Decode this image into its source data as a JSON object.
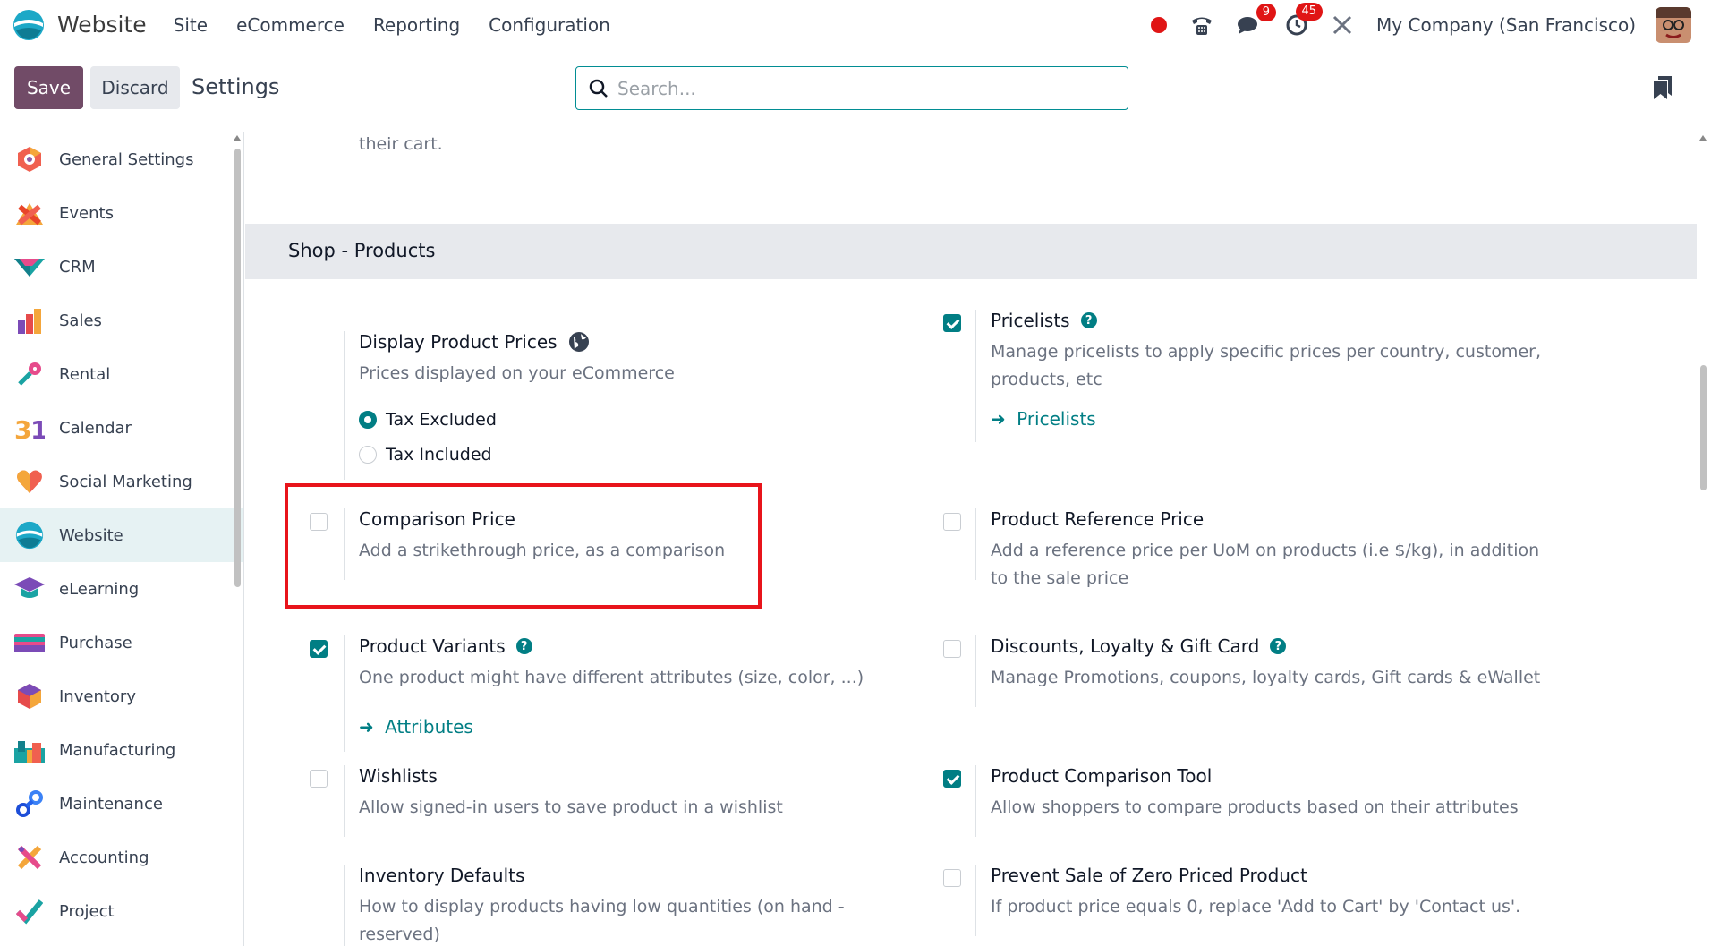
{
  "navbar": {
    "app_title": "Website",
    "menu": [
      "Site",
      "eCommerce",
      "Reporting",
      "Configuration"
    ],
    "messages_count": "9",
    "activities_count": "45",
    "company": "My Company (San Francisco)"
  },
  "controls": {
    "save_label": "Save",
    "discard_label": "Discard",
    "title": "Settings",
    "search_placeholder": "Search..."
  },
  "sidebar": {
    "items": [
      {
        "label": "General Settings",
        "icon": "general-settings-icon"
      },
      {
        "label": "Events",
        "icon": "events-icon"
      },
      {
        "label": "CRM",
        "icon": "crm-icon"
      },
      {
        "label": "Sales",
        "icon": "sales-icon"
      },
      {
        "label": "Rental",
        "icon": "rental-icon"
      },
      {
        "label": "Calendar",
        "icon": "calendar-icon"
      },
      {
        "label": "Social Marketing",
        "icon": "social-marketing-icon"
      },
      {
        "label": "Website",
        "icon": "website-icon",
        "active": true
      },
      {
        "label": "eLearning",
        "icon": "elearning-icon"
      },
      {
        "label": "Purchase",
        "icon": "purchase-icon"
      },
      {
        "label": "Inventory",
        "icon": "inventory-icon"
      },
      {
        "label": "Manufacturing",
        "icon": "manufacturing-icon"
      },
      {
        "label": "Maintenance",
        "icon": "maintenance-icon"
      },
      {
        "label": "Accounting",
        "icon": "accounting-icon"
      },
      {
        "label": "Project",
        "icon": "project-icon"
      }
    ]
  },
  "main": {
    "cart_text": "their cart.",
    "section_title": "Shop - Products",
    "display_prices": {
      "title": "Display Product Prices",
      "desc": "Prices displayed on your eCommerce",
      "options": [
        "Tax Excluded",
        "Tax Included"
      ],
      "selected": "Tax Excluded"
    },
    "pricelists": {
      "title": "Pricelists",
      "desc": "Manage pricelists to apply specific prices per country, customer, products, etc",
      "link": "Pricelists",
      "checked": true
    },
    "comparison_price": {
      "title": "Comparison Price",
      "desc": "Add a strikethrough price, as a comparison",
      "checked": false
    },
    "reference_price": {
      "title": "Product Reference Price",
      "desc": "Add a reference price per UoM on products (i.e $/kg), in addition to the sale price",
      "checked": false
    },
    "variants": {
      "title": "Product Variants",
      "desc": "One product might have different attributes (size, color, ...)",
      "link": "Attributes",
      "checked": true
    },
    "discounts": {
      "title": "Discounts, Loyalty & Gift Card",
      "desc": "Manage Promotions, coupons, loyalty cards, Gift cards & eWallet",
      "checked": false
    },
    "wishlists": {
      "title": "Wishlists",
      "desc": "Allow signed-in users to save product in a wishlist",
      "checked": false
    },
    "comparison_tool": {
      "title": "Product Comparison Tool",
      "desc": "Allow shoppers to compare products based on their attributes",
      "checked": true
    },
    "inventory_defaults": {
      "title": "Inventory Defaults",
      "desc": "How to display products having low quantities (on hand - reserved)"
    },
    "zero_price": {
      "title": "Prevent Sale of Zero Priced Product",
      "desc": "If product price equals 0, replace 'Add to Cart' by 'Contact us'.",
      "checked": false
    }
  },
  "colors": {
    "primary": "#714b67",
    "teal": "#017e84",
    "highlight": "#e8141b",
    "active_bg": "#e6f2f3"
  }
}
